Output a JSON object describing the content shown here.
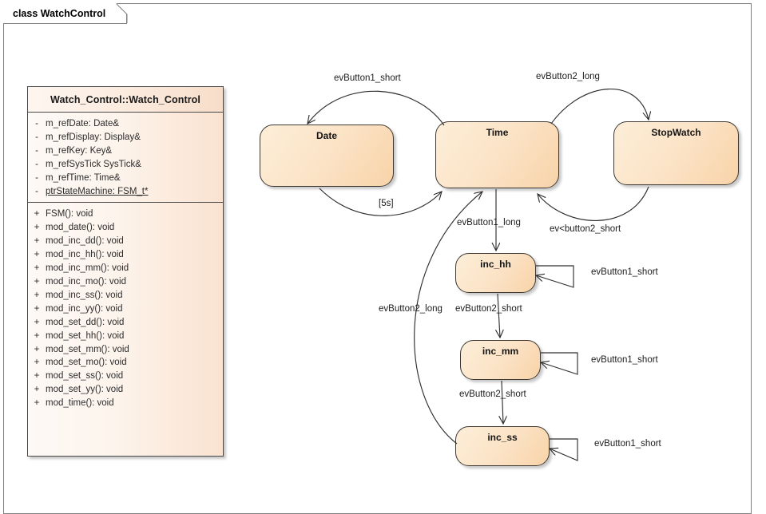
{
  "frame": {
    "label": "class WatchControl"
  },
  "class_box": {
    "title": "Watch_Control::Watch_Control",
    "attributes": [
      {
        "visibility": "-",
        "signature": "m_refDate: Date&",
        "static": false
      },
      {
        "visibility": "-",
        "signature": "m_refDisplay: Display&",
        "static": false
      },
      {
        "visibility": "-",
        "signature": "m_refKey: Key&",
        "static": false
      },
      {
        "visibility": "-",
        "signature": "m_refSysTick SysTick&",
        "static": false
      },
      {
        "visibility": "-",
        "signature": "m_refTime: Time&",
        "static": false
      },
      {
        "visibility": "-",
        "signature": "ptrStateMachine: FSM_t*",
        "static": true
      }
    ],
    "operations": [
      {
        "visibility": "+",
        "signature": "FSM(): void"
      },
      {
        "visibility": "+",
        "signature": "mod_date(): void"
      },
      {
        "visibility": "+",
        "signature": "mod_inc_dd(): void"
      },
      {
        "visibility": "+",
        "signature": "mod_inc_hh(): void"
      },
      {
        "visibility": "+",
        "signature": "mod_inc_mm(): void"
      },
      {
        "visibility": "+",
        "signature": "mod_inc_mo(): void"
      },
      {
        "visibility": "+",
        "signature": "mod_inc_ss(): void"
      },
      {
        "visibility": "+",
        "signature": "mod_inc_yy(): void"
      },
      {
        "visibility": "+",
        "signature": "mod_set_dd(): void"
      },
      {
        "visibility": "+",
        "signature": "mod_set_hh(): void"
      },
      {
        "visibility": "+",
        "signature": "mod_set_mm(): void"
      },
      {
        "visibility": "+",
        "signature": "mod_set_mo(): void"
      },
      {
        "visibility": "+",
        "signature": "mod_set_ss(): void"
      },
      {
        "visibility": "+",
        "signature": "mod_set_yy(): void"
      },
      {
        "visibility": "+",
        "signature": "mod_time(): void"
      }
    ]
  },
  "statechart": {
    "states": [
      {
        "id": "date",
        "label": "Date"
      },
      {
        "id": "time",
        "label": "Time"
      },
      {
        "id": "stopwatch",
        "label": "StopWatch"
      },
      {
        "id": "inc_hh",
        "label": "inc_hh"
      },
      {
        "id": "inc_mm",
        "label": "inc_mm"
      },
      {
        "id": "inc_ss",
        "label": "inc_ss"
      }
    ],
    "transitions": [
      {
        "id": "t1",
        "from": "time",
        "to": "date",
        "label": "evButton1_short"
      },
      {
        "id": "t2",
        "from": "date",
        "to": "time",
        "label": "[5s]"
      },
      {
        "id": "t3",
        "from": "time",
        "to": "stopwatch",
        "label": "evButton2_long"
      },
      {
        "id": "t4",
        "from": "stopwatch",
        "to": "time",
        "label": "ev<button2_short"
      },
      {
        "id": "t5",
        "from": "time",
        "to": "inc_hh",
        "label": "evButton1_long"
      },
      {
        "id": "t6",
        "from": "inc_hh",
        "to": "inc_mm",
        "label": "evButton2_short"
      },
      {
        "id": "t7",
        "from": "inc_mm",
        "to": "inc_ss",
        "label": "evButton2_short"
      },
      {
        "id": "t8",
        "from": "inc_ss",
        "to": "time",
        "label": "evButton2_long"
      },
      {
        "id": "s1",
        "from": "inc_hh",
        "to": "inc_hh",
        "label": "evButton1_short"
      },
      {
        "id": "s2",
        "from": "inc_mm",
        "to": "inc_mm",
        "label": "evButton1_short"
      },
      {
        "id": "s3",
        "from": "inc_ss",
        "to": "inc_ss",
        "label": "evButton1_short"
      }
    ]
  },
  "colors": {
    "state_fill": "#fbe2c4",
    "state_stroke": "#3d3832",
    "class_fill": "#fdf4ec",
    "class_stroke": "#4a4a4a",
    "frame_stroke": "#808080",
    "edge_stroke": "#2f2f2f"
  }
}
